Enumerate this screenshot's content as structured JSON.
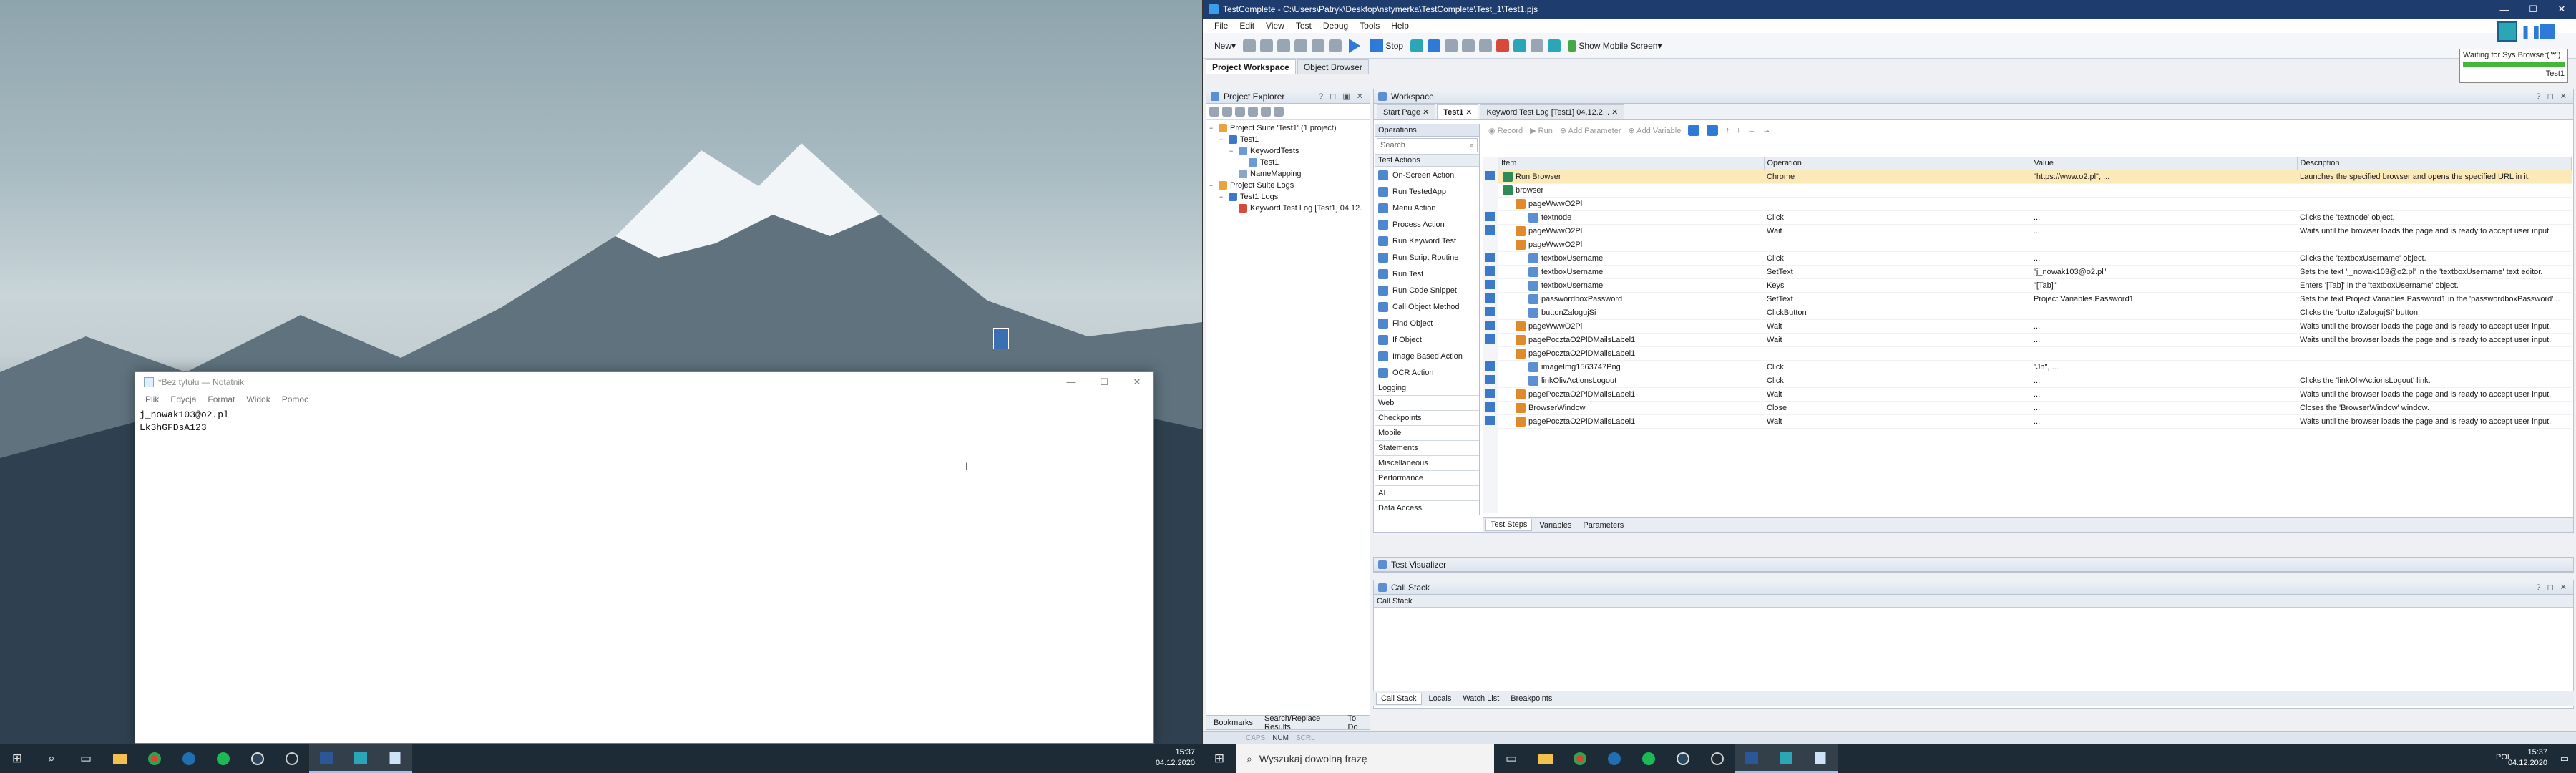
{
  "notepad": {
    "title": "*Bez tytułu — Notatnik",
    "menu": [
      "Plik",
      "Edycja",
      "Format",
      "Widok",
      "Pomoc"
    ],
    "lines": [
      "j_nowak103@o2.pl",
      "Lk3hGFDsA123"
    ]
  },
  "taskbar_left": {
    "time": "15:37",
    "date": "04.12.2020"
  },
  "testcomplete": {
    "title": "TestComplete - C:\\Users\\Patryk\\Desktop\\nstymerka\\TestComplete\\Test_1\\Test1.pjs",
    "menu": [
      "File",
      "Edit",
      "View",
      "Test",
      "Debug",
      "Tools",
      "Help"
    ],
    "toolbar": {
      "new_label": "New",
      "stop_label": "Stop",
      "mobile_label": "Show Mobile Screen"
    },
    "workspace_tabs": [
      "Project Workspace",
      "Object Browser"
    ],
    "project_explorer": {
      "title": "Project Explorer",
      "tree": [
        {
          "label": "Project Suite 'Test1' (1 project)",
          "level": 0,
          "expand": "−"
        },
        {
          "label": "Test1",
          "level": 1,
          "expand": "−"
        },
        {
          "label": "KeywordTests",
          "level": 2,
          "expand": "−"
        },
        {
          "label": "Test1",
          "level": 3,
          "expand": ""
        },
        {
          "label": "NameMapping",
          "level": 2,
          "expand": ""
        },
        {
          "label": "Project Suite Logs",
          "level": 0,
          "expand": "−"
        },
        {
          "label": "Test1 Logs",
          "level": 1,
          "expand": "−"
        },
        {
          "label": "Keyword Test Log [Test1] 04.12.",
          "level": 2,
          "expand": ""
        }
      ],
      "bottom_tabs": [
        "Bookmarks",
        "Search/Replace Results",
        "To Do"
      ]
    },
    "workspace": {
      "title": "Workspace",
      "tabs": [
        "Start Page",
        "Test1",
        "Keyword Test Log [Test1] 04.12.2..."
      ],
      "editor_toolbar": [
        "Record",
        "Run",
        "Add Parameter",
        "Add Variable"
      ],
      "operations": {
        "title": "Operations",
        "search_placeholder": "Search",
        "test_actions_label": "Test Actions",
        "items": [
          "On-Screen Action",
          "Run TestedApp",
          "Menu Action",
          "Process Action",
          "Run Keyword Test",
          "Run Script Routine",
          "Run Test",
          "Run Code Snippet",
          "Call Object Method",
          "Find Object",
          "If Object",
          "Image Based Action",
          "OCR Action"
        ],
        "groups": [
          "Logging",
          "Web",
          "Checkpoints",
          "Mobile",
          "Statements",
          "Miscellaneous",
          "Performance",
          "AI",
          "Data Access"
        ]
      },
      "columns": [
        "Item",
        "Operation",
        "Value",
        "Description"
      ],
      "rows": [
        {
          "item": "Run Browser",
          "level": 0,
          "op": "Chrome",
          "value": "\"https://www.o2.pl\", ...",
          "desc": "Launches the specified browser and opens the specified URL in it.",
          "sel": true
        },
        {
          "item": "browser",
          "level": 0,
          "op": "",
          "value": "",
          "desc": ""
        },
        {
          "item": "pageWwwO2Pl",
          "level": 1,
          "op": "",
          "value": "",
          "desc": ""
        },
        {
          "item": "textnode",
          "level": 2,
          "op": "Click",
          "value": "...",
          "desc": "Clicks the 'textnode' object."
        },
        {
          "item": "pageWwwO2Pl",
          "level": 1,
          "op": "Wait",
          "value": "...",
          "desc": "Waits until the browser loads the page and is ready to accept user input."
        },
        {
          "item": "pageWwwO2Pl",
          "level": 1,
          "op": "",
          "value": "",
          "desc": ""
        },
        {
          "item": "textboxUsername",
          "level": 2,
          "op": "Click",
          "value": "...",
          "desc": "Clicks the 'textboxUsername' object."
        },
        {
          "item": "textboxUsername",
          "level": 2,
          "op": "SetText",
          "value": "\"j_nowak103@o2.pl\"",
          "desc": "Sets the text 'j_nowak103@o2.pl' in the 'textboxUsername' text editor."
        },
        {
          "item": "textboxUsername",
          "level": 2,
          "op": "Keys",
          "value": "\"[Tab]\"",
          "desc": "Enters '[Tab]' in the 'textboxUsername' object."
        },
        {
          "item": "passwordboxPassword",
          "level": 2,
          "op": "SetText",
          "value": "Project.Variables.Password1",
          "desc": "Sets the text Project.Variables.Password1 in the 'passwordboxPassword'..."
        },
        {
          "item": "buttonZalogujSi",
          "level": 2,
          "op": "ClickButton",
          "value": "",
          "desc": "Clicks the 'buttonZalogujSi' button."
        },
        {
          "item": "pageWwwO2Pl",
          "level": 1,
          "op": "Wait",
          "value": "...",
          "desc": "Waits until the browser loads the page and is ready to accept user input."
        },
        {
          "item": "pagePocztaO2PlDMailsLabel1",
          "level": 1,
          "op": "Wait",
          "value": "...",
          "desc": "Waits until the browser loads the page and is ready to accept user input."
        },
        {
          "item": "pagePocztaO2PlDMailsLabel1",
          "level": 1,
          "op": "",
          "value": "",
          "desc": ""
        },
        {
          "item": "imageImg1563747Png",
          "level": 2,
          "op": "Click",
          "value": "\"Jh\", ...",
          "desc": ""
        },
        {
          "item": "linkOlivActionsLogout",
          "level": 2,
          "op": "Click",
          "value": "...",
          "desc": "Clicks the 'linkOlivActionsLogout' link."
        },
        {
          "item": "pagePocztaO2PlDMailsLabel1",
          "level": 1,
          "op": "Wait",
          "value": "...",
          "desc": "Waits until the browser loads the page and is ready to accept user input."
        },
        {
          "item": "BrowserWindow",
          "level": 1,
          "op": "Close",
          "value": "...",
          "desc": "Closes the 'BrowserWindow' window."
        },
        {
          "item": "pagePocztaO2PlDMailsLabel1",
          "level": 1,
          "op": "Wait",
          "value": "...",
          "desc": "Waits until the browser loads the page and is ready to accept user input."
        }
      ],
      "bottom_tabs": [
        "Test Steps",
        "Variables",
        "Parameters"
      ]
    },
    "test_visualizer": "Test Visualizer",
    "call_stack": {
      "title": "Call Stack",
      "header": "Call Stack"
    },
    "debug_tabs": [
      "Call Stack",
      "Locals",
      "Watch List",
      "Breakpoints"
    ],
    "status": [
      "CAPS",
      "NUM",
      "SCRL"
    ],
    "waiting": {
      "text": "Waiting for Sys.Browser(\"*\")",
      "test": "Test1"
    }
  },
  "taskbar_right": {
    "search": "Wyszukaj dowolną frazę",
    "lang": "POL",
    "time": "15:37",
    "date": "04.12.2020"
  }
}
